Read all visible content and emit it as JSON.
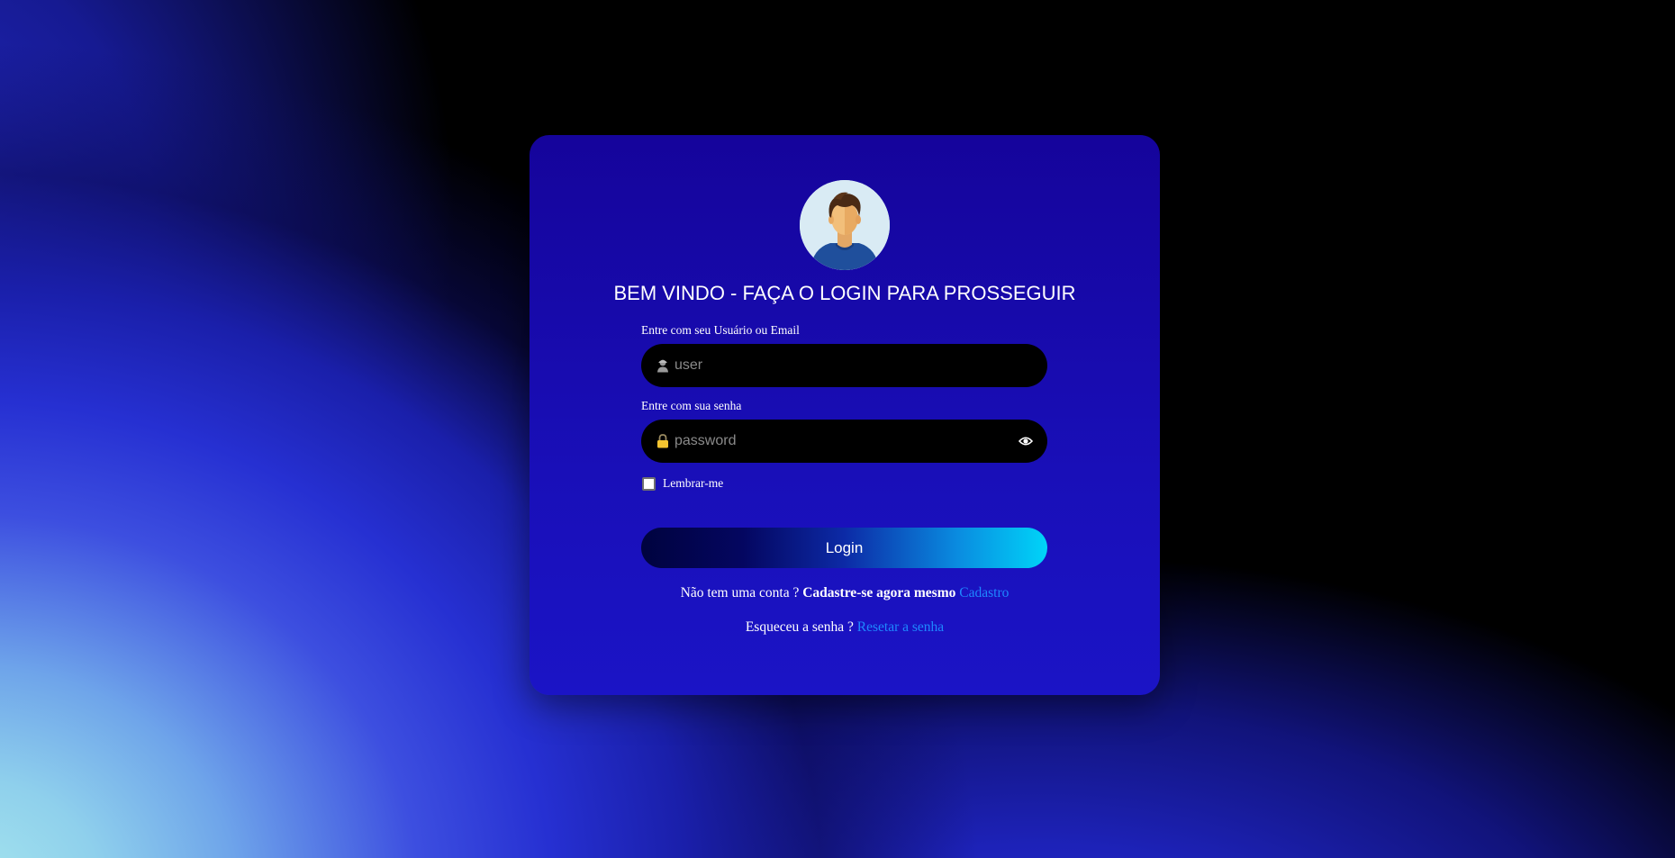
{
  "page": {
    "title": "BEM VINDO - FAÇA O LOGIN PARA PROSSEGUIR"
  },
  "avatar": {
    "icon": "user-avatar-icon"
  },
  "username": {
    "label": "Entre com seu Usuário ou Email",
    "placeholder": "user",
    "value": "",
    "icon": "user-icon"
  },
  "password": {
    "label": "Entre com sua senha",
    "placeholder": "password",
    "value": "",
    "icon": "lock-icon",
    "toggle_icon": "eye-icon"
  },
  "remember": {
    "label": "Lembrar-me",
    "checked": false
  },
  "login_button": {
    "label": "Login"
  },
  "signup": {
    "prompt": "Não tem uma conta ?",
    "emphasis": "Cadastre-se agora mesmo",
    "link_label": "Cadastro"
  },
  "reset": {
    "prompt": "Esqueceu a senha ?",
    "link_label": "Resetar a senha"
  },
  "colors": {
    "card": "#15049b",
    "link": "#1e88ff",
    "button_gradient_start": "#00033f",
    "button_gradient_end": "#00d4f8",
    "lock_icon": "#f4c430"
  }
}
